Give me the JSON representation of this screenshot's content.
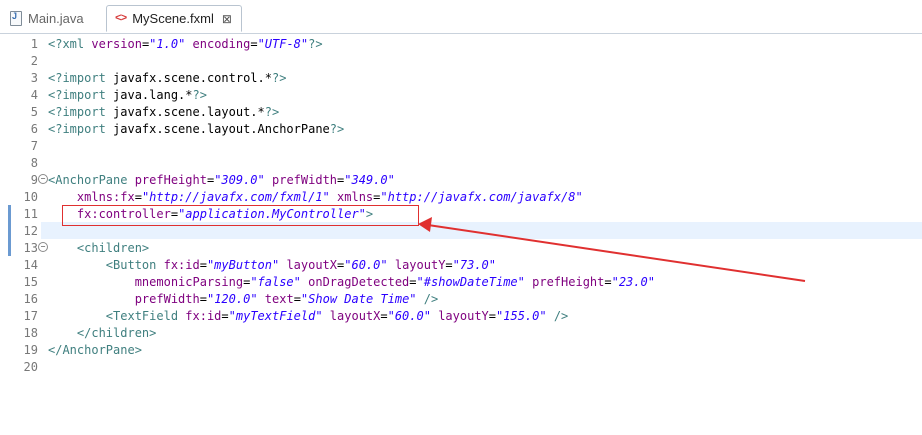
{
  "tabs": [
    {
      "label": "Main.java",
      "icon": "java-file-icon",
      "active": false
    },
    {
      "label": "MyScene.fxml",
      "icon": "fxml-file-icon",
      "active": true,
      "close": "⊠"
    }
  ],
  "editor": {
    "line_numbers": [
      "1",
      "2",
      "3",
      "4",
      "5",
      "6",
      "7",
      "8",
      "9",
      "10",
      "11",
      "12",
      "13",
      "14",
      "15",
      "16",
      "17",
      "18",
      "19",
      "20"
    ],
    "current_line": "12",
    "colors": {
      "processing_instruction": "#3f7f7f",
      "tag": "#3f7f7f",
      "attribute": "#7f007f",
      "value": "#2a00ff",
      "annotation": "#e03030"
    },
    "lines": [
      [
        {
          "t": "pi",
          "s": "<?xml "
        },
        {
          "t": "attr",
          "s": "version"
        },
        {
          "t": "txt",
          "s": "="
        },
        {
          "t": "val",
          "s": "\"1.0\""
        },
        {
          "t": "txt",
          "s": " "
        },
        {
          "t": "attr",
          "s": "encoding"
        },
        {
          "t": "txt",
          "s": "="
        },
        {
          "t": "val",
          "s": "\"UTF-8\""
        },
        {
          "t": "pi",
          "s": "?>"
        }
      ],
      [],
      [
        {
          "t": "pi",
          "s": "<?import "
        },
        {
          "t": "txt",
          "s": "javafx.scene.control.*"
        },
        {
          "t": "pi",
          "s": "?>"
        }
      ],
      [
        {
          "t": "pi",
          "s": "<?import "
        },
        {
          "t": "txt",
          "s": "java.lang.*"
        },
        {
          "t": "pi",
          "s": "?>"
        }
      ],
      [
        {
          "t": "pi",
          "s": "<?import "
        },
        {
          "t": "txt",
          "s": "javafx.scene.layout.*"
        },
        {
          "t": "pi",
          "s": "?>"
        }
      ],
      [
        {
          "t": "pi",
          "s": "<?import "
        },
        {
          "t": "txt",
          "s": "javafx.scene.layout.AnchorPane"
        },
        {
          "t": "pi",
          "s": "?>"
        }
      ],
      [],
      [],
      [
        {
          "t": "tag",
          "s": "<AnchorPane "
        },
        {
          "t": "attr",
          "s": "prefHeight"
        },
        {
          "t": "txt",
          "s": "="
        },
        {
          "t": "val",
          "s": "\"309.0\""
        },
        {
          "t": "txt",
          "s": " "
        },
        {
          "t": "attr",
          "s": "prefWidth"
        },
        {
          "t": "txt",
          "s": "="
        },
        {
          "t": "val",
          "s": "\"349.0\""
        }
      ],
      [
        {
          "t": "txt",
          "s": "    "
        },
        {
          "t": "attr",
          "s": "xmlns:fx"
        },
        {
          "t": "txt",
          "s": "="
        },
        {
          "t": "val",
          "s": "\"http://javafx.com/fxml/1\""
        },
        {
          "t": "txt",
          "s": " "
        },
        {
          "t": "attr",
          "s": "xmlns"
        },
        {
          "t": "txt",
          "s": "="
        },
        {
          "t": "val",
          "s": "\"http://javafx.com/javafx/8\""
        }
      ],
      [
        {
          "t": "txt",
          "s": "    "
        },
        {
          "t": "attr",
          "s": "fx:controller"
        },
        {
          "t": "txt",
          "s": "="
        },
        {
          "t": "val",
          "s": "\"application.MyController\""
        },
        {
          "t": "tag",
          "s": ">"
        }
      ],
      [],
      [
        {
          "t": "txt",
          "s": "    "
        },
        {
          "t": "tag",
          "s": "<children>"
        }
      ],
      [
        {
          "t": "txt",
          "s": "        "
        },
        {
          "t": "tag",
          "s": "<Button "
        },
        {
          "t": "attr",
          "s": "fx:id"
        },
        {
          "t": "txt",
          "s": "="
        },
        {
          "t": "val",
          "s": "\"myButton\""
        },
        {
          "t": "txt",
          "s": " "
        },
        {
          "t": "attr",
          "s": "layoutX"
        },
        {
          "t": "txt",
          "s": "="
        },
        {
          "t": "val",
          "s": "\"60.0\""
        },
        {
          "t": "txt",
          "s": " "
        },
        {
          "t": "attr",
          "s": "layoutY"
        },
        {
          "t": "txt",
          "s": "="
        },
        {
          "t": "val",
          "s": "\"73.0\""
        }
      ],
      [
        {
          "t": "txt",
          "s": "            "
        },
        {
          "t": "attr",
          "s": "mnemonicParsing"
        },
        {
          "t": "txt",
          "s": "="
        },
        {
          "t": "val",
          "s": "\"false\""
        },
        {
          "t": "txt",
          "s": " "
        },
        {
          "t": "attr",
          "s": "onDragDetected"
        },
        {
          "t": "txt",
          "s": "="
        },
        {
          "t": "val",
          "s": "\"#showDateTime\""
        },
        {
          "t": "txt",
          "s": " "
        },
        {
          "t": "attr",
          "s": "prefHeight"
        },
        {
          "t": "txt",
          "s": "="
        },
        {
          "t": "val",
          "s": "\"23.0\""
        }
      ],
      [
        {
          "t": "txt",
          "s": "            "
        },
        {
          "t": "attr",
          "s": "prefWidth"
        },
        {
          "t": "txt",
          "s": "="
        },
        {
          "t": "val",
          "s": "\"120.0\""
        },
        {
          "t": "txt",
          "s": " "
        },
        {
          "t": "attr",
          "s": "text"
        },
        {
          "t": "txt",
          "s": "="
        },
        {
          "t": "val",
          "s": "\"Show Date Time\""
        },
        {
          "t": "txt",
          "s": " "
        },
        {
          "t": "tag",
          "s": "/>"
        }
      ],
      [
        {
          "t": "txt",
          "s": "        "
        },
        {
          "t": "tag",
          "s": "<TextField "
        },
        {
          "t": "attr",
          "s": "fx:id"
        },
        {
          "t": "txt",
          "s": "="
        },
        {
          "t": "val",
          "s": "\"myTextField\""
        },
        {
          "t": "txt",
          "s": " "
        },
        {
          "t": "attr",
          "s": "layoutX"
        },
        {
          "t": "txt",
          "s": "="
        },
        {
          "t": "val",
          "s": "\"60.0\""
        },
        {
          "t": "txt",
          "s": " "
        },
        {
          "t": "attr",
          "s": "layoutY"
        },
        {
          "t": "txt",
          "s": "="
        },
        {
          "t": "val",
          "s": "\"155.0\""
        },
        {
          "t": "txt",
          "s": " "
        },
        {
          "t": "tag",
          "s": "/>"
        }
      ],
      [
        {
          "t": "txt",
          "s": "    "
        },
        {
          "t": "tag",
          "s": "</children>"
        }
      ],
      [
        {
          "t": "tag",
          "s": "</AnchorPane>"
        }
      ],
      []
    ]
  }
}
